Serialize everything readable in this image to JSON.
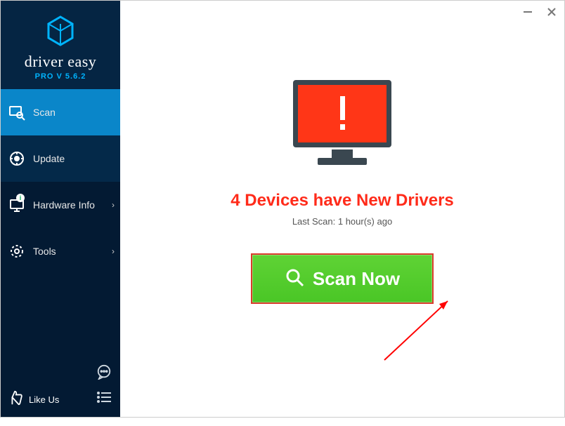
{
  "app": {
    "name_logo": "driver easy",
    "version_line": "PRO V 5.6.2"
  },
  "sidebar": {
    "items": [
      {
        "label": "Scan",
        "icon": "scan-icon"
      },
      {
        "label": "Update",
        "icon": "update-icon"
      },
      {
        "label": "Hardware Info",
        "icon": "hardware-icon"
      },
      {
        "label": "Tools",
        "icon": "tools-icon"
      }
    ],
    "like_label": "Like Us"
  },
  "main": {
    "headline": "4 Devices have New Drivers",
    "last_scan": "Last Scan: 1 hour(s) ago",
    "scan_button_label": "Scan Now"
  },
  "colors": {
    "accent_red": "#ff2b1a",
    "scan_green": "#4ac626",
    "sidebar_bg": "#031a33",
    "active_blue": "#0a86c9"
  }
}
